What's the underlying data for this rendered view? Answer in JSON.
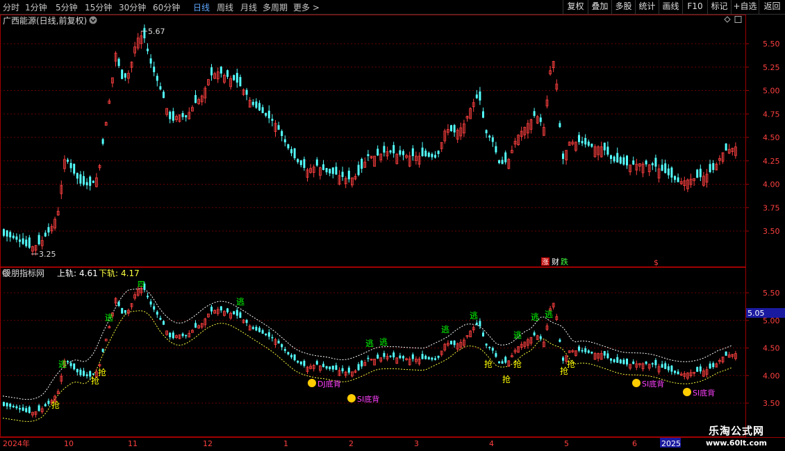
{
  "toolbar": {
    "periods": [
      "分时",
      "1分钟",
      "5分钟",
      "15分钟",
      "30分钟",
      "60分钟",
      "日线",
      "周线",
      "月线",
      "多周期",
      "更多 >"
    ],
    "active_period": "日线",
    "right_buttons": [
      "复权",
      "叠加",
      "多股",
      "统计",
      "画线",
      "F10",
      "标记",
      "+自选",
      "返回"
    ]
  },
  "main_panel": {
    "title": "广西能源(日线,前复权)",
    "high_label": "5.67",
    "low_label": "3.25",
    "price_ticks": [
      "5.50",
      "5.25",
      "5.00",
      "4.75",
      "4.50",
      "4.25",
      "4.00",
      "3.75",
      "3.50"
    ],
    "event_labels": [
      "涨",
      "财",
      "跌"
    ],
    "event_mark": "$"
  },
  "indicator_panel": {
    "title": "股朋指标网",
    "upper_label": "上轨:",
    "upper_value": "4.61",
    "lower_label": "下轨:",
    "lower_value": "4.17",
    "price_ticks": [
      "5.50",
      "5.00",
      "4.50",
      "4.00",
      "3.50"
    ],
    "current_price": "5.05",
    "signal_buy": "抢",
    "signal_sell": "逃",
    "signal_top": "四",
    "annotations": [
      "DJ底背",
      "SI底背",
      "SI底背",
      "SI底背"
    ]
  },
  "date_axis": {
    "labels": [
      "2024年",
      "10",
      "11",
      "12",
      "1",
      "2",
      "3",
      "4",
      "5",
      "6",
      "2025"
    ]
  },
  "watermark": {
    "text": "乐淘公式网",
    "url": "www.60lt.com"
  },
  "colors": {
    "up": "#ff4040",
    "down": "#54ffff",
    "upper_band": "#ffffff",
    "lower_band": "#ffff40",
    "buy_text": "#ffff00",
    "sell_text": "#00ff00",
    "frame": "#a00000",
    "annotation": "#ff40ff"
  }
}
